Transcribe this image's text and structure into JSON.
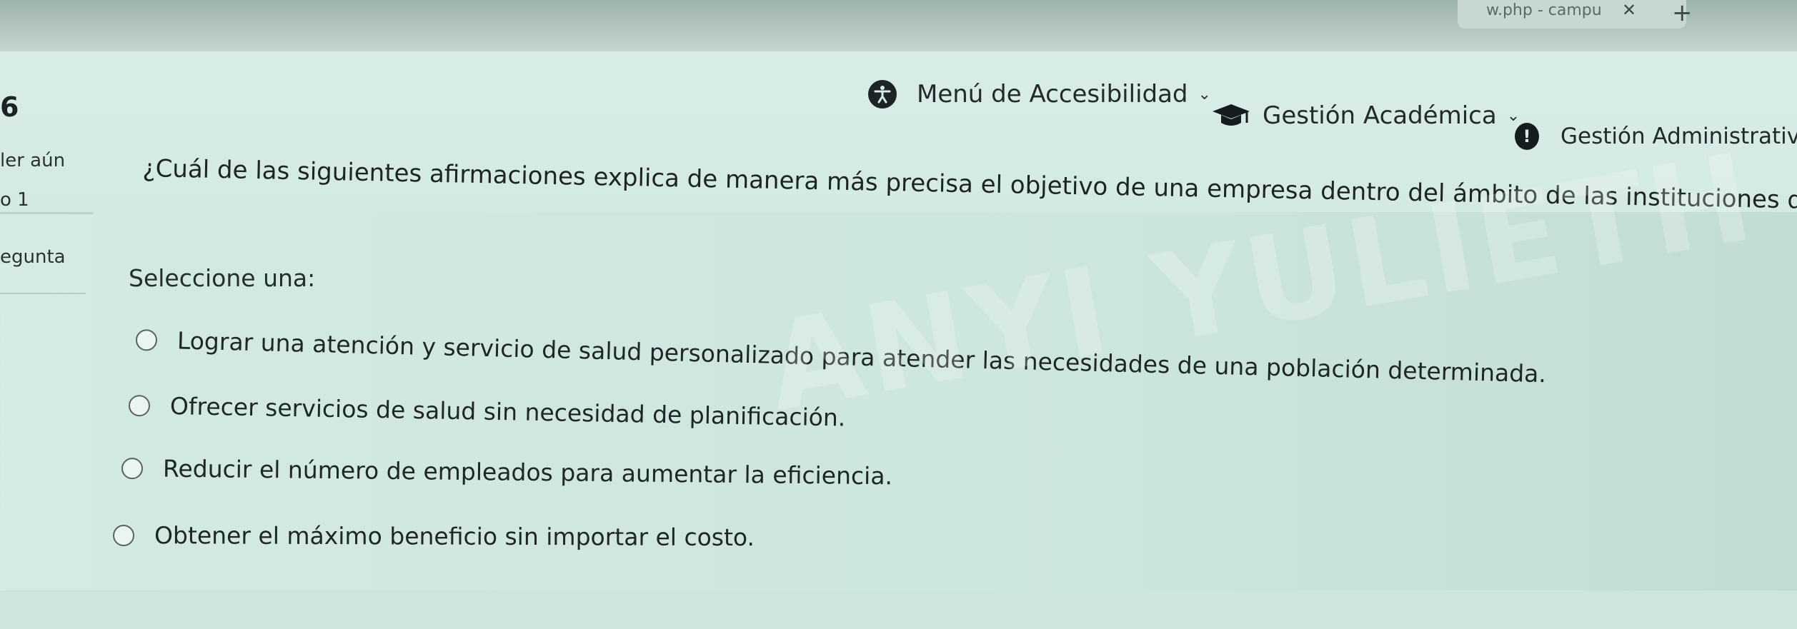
{
  "browser": {
    "tab_title": "w.php - campu",
    "tab_close_glyph": "✕",
    "new_tab_glyph": "+"
  },
  "navbar": {
    "items": [
      {
        "label": "Menú de Accesibilidad",
        "icon": "accessibility-icon"
      },
      {
        "label": "Gestión Académica",
        "icon": "graduation-cap-icon"
      },
      {
        "label": "Gestión Administrativa",
        "icon": "info-icon"
      }
    ],
    "chevron": "⌄"
  },
  "question_info": {
    "number": "6",
    "state": "ler aún",
    "score": "o 1",
    "flag": "egunta"
  },
  "question": {
    "text": "¿Cuál de las siguientes afirmaciones explica de manera más precisa el objetivo de una empresa dentro del ámbito de las instituciones de salud?",
    "select_label": "Seleccione una:",
    "options": [
      "Lograr una atención y servicio de salud personalizado para atender las necesidades de una población determinada.",
      "Ofrecer servicios de salud sin necesidad de planificación.",
      "Reducir el número de empleados para aumentar la eficiencia.",
      "Obtener el máximo beneficio sin importar el costo."
    ]
  },
  "watermark": "ANYI YULIETH MUNOZ MUN",
  "colors": {
    "background": "#d3e9e3",
    "text": "#1f2526",
    "radio_border": "#5a6563"
  }
}
